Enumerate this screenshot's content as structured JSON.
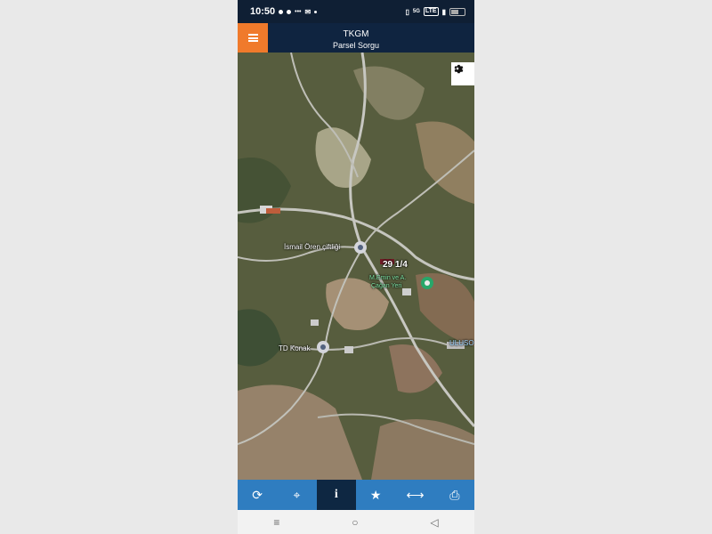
{
  "status": {
    "time": "10:50",
    "network_text": "5G",
    "lte": "LTE"
  },
  "header": {
    "title": "TKGM",
    "subtitle": "Parsel Sorgu"
  },
  "map": {
    "labels": [
      {
        "id": "ismail",
        "text": "İsmail Ören çiftliği"
      },
      {
        "id": "parcel",
        "text": "29 1/4"
      },
      {
        "id": "memin_line1",
        "text": "M.Emin ve A."
      },
      {
        "id": "memin_line2",
        "text": "Çağan Yeri"
      },
      {
        "id": "konak",
        "text": "TD Konak"
      },
      {
        "id": "ulusoy",
        "text": "ULUSO"
      }
    ]
  },
  "toolbar": {
    "items": [
      "refresh",
      "locate",
      "info",
      "favorite",
      "measure",
      "print"
    ],
    "active": "info"
  },
  "icons": {
    "refresh": "refresh-icon",
    "locate": "crosshair-icon",
    "info": "info-icon",
    "favorite": "star-icon",
    "measure": "arrows-horizontal-icon",
    "print": "printer-icon",
    "settings": "gear-icon"
  },
  "colors": {
    "accent": "#f07a2b",
    "toolbar": "#2f7dc0",
    "header": "#0f2440"
  }
}
